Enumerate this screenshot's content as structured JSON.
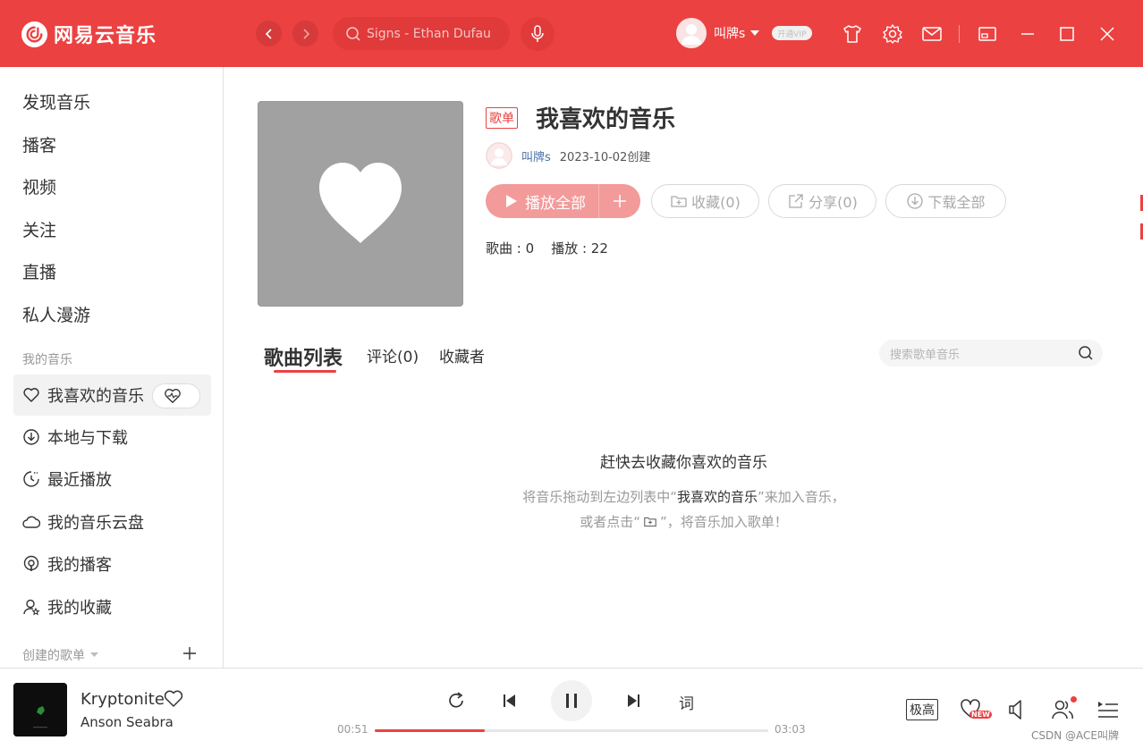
{
  "app": {
    "name": "网易云音乐"
  },
  "header": {
    "search_placeholder": "Signs - Ethan Dufau",
    "user_name": "叫牌s",
    "vip_label": "开通VIP"
  },
  "sidebar": {
    "main_items": [
      {
        "label": "发现音乐"
      },
      {
        "label": "播客"
      },
      {
        "label": "视频"
      },
      {
        "label": "关注"
      },
      {
        "label": "直播"
      },
      {
        "label": "私人漫游"
      }
    ],
    "my_music_title": "我的音乐",
    "my_items": [
      {
        "label": "我喜欢的音乐",
        "icon": "heart-icon",
        "active": true
      },
      {
        "label": "本地与下载",
        "icon": "download-icon"
      },
      {
        "label": "最近播放",
        "icon": "clock-icon"
      },
      {
        "label": "我的音乐云盘",
        "icon": "cloud-icon"
      },
      {
        "label": "我的播客",
        "icon": "podcast-icon"
      },
      {
        "label": "我的收藏",
        "icon": "collection-icon"
      }
    ],
    "created_title": "创建的歌单"
  },
  "playlist": {
    "tag": "歌单",
    "title": "我喜欢的音乐",
    "creator": "叫牌s",
    "created": "2023-10-02创建",
    "play_all": "播放全部",
    "collect": "收藏(0)",
    "share": "分享(0)",
    "download": "下载全部",
    "stats": "歌曲 : 0    播放 : 22"
  },
  "tabs": [
    {
      "label": "歌曲列表",
      "active": true
    },
    {
      "label": "评论(0)"
    },
    {
      "label": "收藏者"
    }
  ],
  "playlist_search_placeholder": "搜索歌单音乐",
  "empty": {
    "title": "赶快去收藏你喜欢的音乐",
    "line1_pre": "将音乐拖动到左边列表中“",
    "line1_name": "我喜欢的音乐",
    "line1_post": "”来加入音乐，",
    "line2_pre": "或者点击“",
    "line2_post": "”，将音乐加入歌单！"
  },
  "player": {
    "song": "Kryptonite",
    "artist": "Anson Seabra",
    "current_time": "00:51",
    "total_time": "03:03",
    "progress": 0.28,
    "lyric_label": "词",
    "quality": "极高",
    "new_badge": "NEW"
  },
  "watermark": "CSDN @ACE叫牌",
  "colors": {
    "accent": "#ec4141",
    "cover": "#a1a1a1",
    "button_play": "#f39a9a"
  }
}
